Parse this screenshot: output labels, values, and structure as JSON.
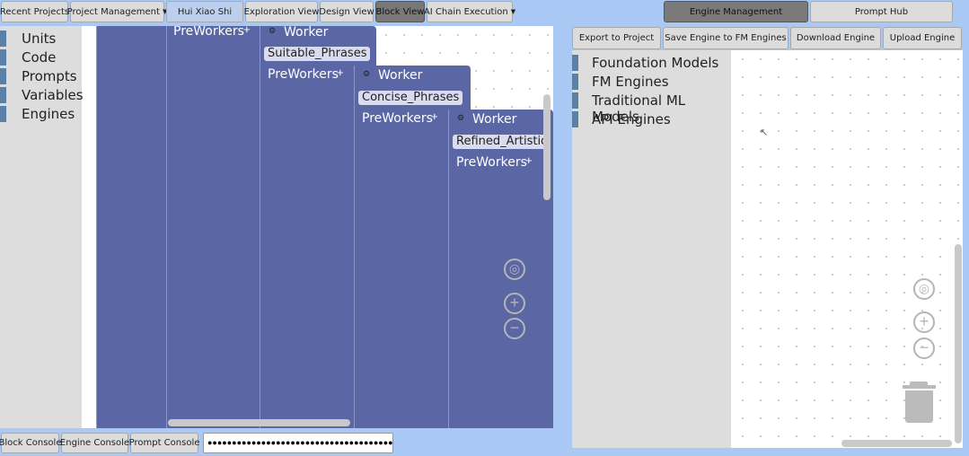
{
  "top_nav": {
    "recent_projects": "Recent Projects",
    "project_management": "Project Management",
    "user_name": "Hui Xiao Shi",
    "exploration_view": "Exploration View",
    "design_view": "Design View",
    "block_view": "Block View",
    "ai_chain_execution": "AI Chain Execution"
  },
  "right_tabs": {
    "engine_management": "Engine Management",
    "prompt_hub": "Prompt Hub"
  },
  "engine_toolbar": {
    "export_to_project": "Export to Project",
    "save_engine": "Save Engine to FM Engines",
    "download_engine": "Download Engine",
    "upload_engine": "Upload Engine"
  },
  "toolbox": {
    "items": [
      "Units",
      "Code",
      "Prompts",
      "Variables",
      "Engines"
    ]
  },
  "blocks": {
    "preworkers_label": "PreWorkers",
    "worker_label": "Worker",
    "fields": [
      "Suitable_Phrases",
      "Concise_Phrases",
      "Refined_Artistic"
    ]
  },
  "engine_list": {
    "items": [
      "Foundation Models",
      "FM Engines",
      "Traditional ML Models",
      "API Engines"
    ]
  },
  "console": {
    "block_console": "Block Console",
    "engine_console": "Engine Console",
    "prompt_console": "Prompt Console",
    "input_value": "●●●●●●●●●●●●●●●●●●●●●●●●●●●●●●●●●●●●●●●●●●●●●"
  },
  "icons": {
    "dropdown": "caret-down",
    "recenter": "crosshair",
    "zoom_in": "plus-circle",
    "zoom_out": "minus-circle",
    "trash": "trash-can",
    "worker_gear": "gear"
  },
  "colors": {
    "block": "#5b67a5",
    "toolbox_mark": "#5b80a5",
    "app_background": "#a9c8f3"
  }
}
